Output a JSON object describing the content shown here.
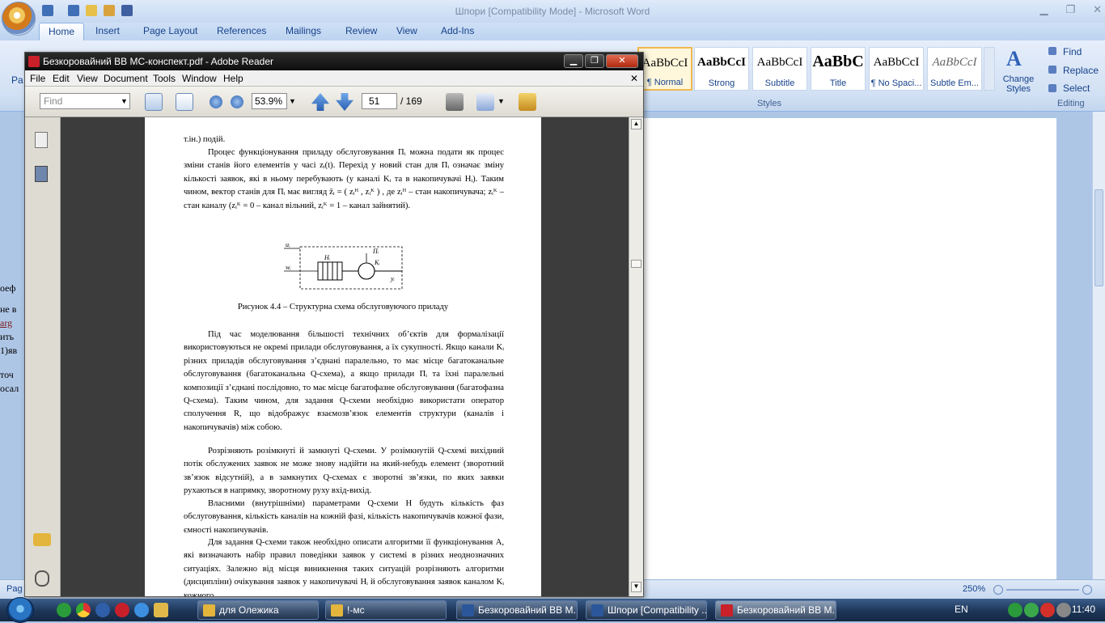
{
  "word": {
    "title": "Шпори [Compatibility Mode] - Microsoft Word",
    "tabs": [
      "Home",
      "Insert",
      "Page Layout",
      "References",
      "Mailings",
      "Review",
      "View",
      "Add-Ins"
    ],
    "styles": [
      {
        "sample": "AaBbCcI",
        "label": "¶ Normal"
      },
      {
        "sample": "AaBbCcI",
        "label": "Strong"
      },
      {
        "sample": "AaBbCcI",
        "label": "Subtitle"
      },
      {
        "sample": "AaBbC",
        "label": "Title"
      },
      {
        "sample": "AaBbCcI",
        "label": "¶ No Spaci..."
      },
      {
        "sample": "AaBbCcI",
        "label": "Subtle Em..."
      }
    ],
    "change_styles": "Change Styles",
    "styles_group": "Styles",
    "editing": {
      "find": "Find",
      "replace": "Replace",
      "select": "Select",
      "group": "Editing"
    },
    "status": {
      "page": "Pag",
      "zoom": "250%"
    },
    "left_fragments": [
      "оеф",
      "не в",
      "arg",
      "ить",
      "1)яв",
      "точ",
      "осал"
    ],
    "paste_label": "Pa"
  },
  "adobe": {
    "title": "Безкоровайний ВВ МС-конспект.pdf - Adobe Reader",
    "menu": [
      "File",
      "Edit",
      "View",
      "Document",
      "Tools",
      "Window",
      "Help"
    ],
    "find_placeholder": "Find",
    "zoom": "53.9%",
    "page": "51",
    "page_total": "/ 169"
  },
  "pdf": {
    "p1": "т.ін.) подій.",
    "p2": "Процес функціонування приладу обслуговування Пᵢ можна подати як процес зміни станів його елементів у часі zᵢ(t). Перехід у новий стан для Пᵢ означає зміну кількості заявок, які в ньому перебувають (у каналі Kᵢ та в накопичувачі Hᵢ). Таким чином, вектор станів для Пᵢ має вигляд z̄ᵢ = ( zᵢᴴ , zᵢᴷ ) , де zᵢᴴ – стан накопичувача; zᵢᴷ – стан каналу (zᵢᴷ = 0 – канал вільний, zᵢᴷ = 1 – канал зайнятий).",
    "caption": "Рисунок 4.4 – Структурна схема обслуговуючого приладу",
    "diagram": {
      "u": "uᵢ",
      "w": "wᵢ",
      "h": "Hᵢ",
      "p": "Пᵢ",
      "k": "Kᵢ",
      "y": "yᵢ"
    },
    "p3": "Під час моделювання більшості технічних об’єктів для формалізації використовуються не окремі прилади обслуговування, а їх сукупності. Якщо канали Kᵢ різних приладів обслуговування з’єднані паралельно, то має місце багатоканальне обслуговування (багатоканальна Q-схема), а якщо прилади Пᵢ та їхні паралельні композиції з’єднані послідовно, то має місце багатофазне обслуговування (багатофазна Q-схема). Таким чином, для задання Q-схеми необхідно використати оператор сполучення R, що відображує взаємозв’язок елементів структури (каналів і накопичувачів) між собою.",
    "p4": "Розрізняють розімкнуті й замкнуті Q-схеми. У розімкнутій Q-схемі вихідний потік обслужених заявок не може знову надійти на який-небудь елемент (зворотний зв’язок відсутній), а в замкнутих Q-схемах є зворотні зв’язки, по яких заявки рухаються в напрямку, зворотному руху вхід-вихід.",
    "p5": "Власними (внутрішніми) параметрами Q-схеми H будуть кількість фаз обслуговування, кількість каналів на кожній фазі, кількість накопичувачів кожної фази, ємності накопичувачів.",
    "p6": "Для задання Q-схеми також необхідно описати алгоритми її функціонування A, які визначають набір правил поведінки заявок у системі в різних неоднозначних ситуаціях. Залежно від місця виникнення таких ситуацій розрізняють алгоритми (дисципліни) очікування заявок у накопичувачі Hᵢ й обслуговування заявок каналом Kᵢ кожного"
  },
  "taskbar": {
    "tasks": [
      "для Олежика",
      "!-мс",
      "Безкоровайний ВВ М...",
      "Шпори [Compatibility ...",
      "Безкоровайний ВВ М..."
    ],
    "lang": "EN",
    "clock": "11:40"
  },
  "colors": {
    "word_accent": "#15428b",
    "adobe_red": "#c9202a",
    "taskbar": "#1d3557"
  }
}
